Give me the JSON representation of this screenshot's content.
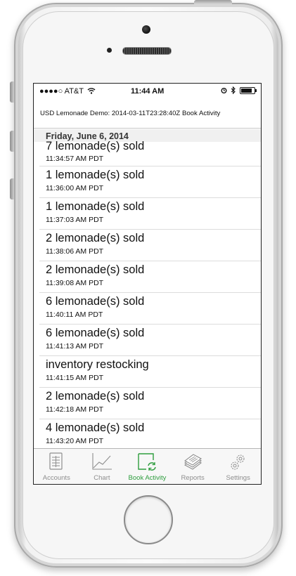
{
  "status_bar": {
    "carrier": "●●●●○ AT&T",
    "time": "11:44 AM",
    "battery_level": 0.85
  },
  "nav": {
    "title": "USD Lemonade Demo: 2014-03-11T23:28:40Z Book Activity"
  },
  "section": {
    "header": "Friday, June 6, 2014"
  },
  "entries": [
    {
      "title": "7 lemonade(s) sold",
      "time": "11:34:57 AM PDT"
    },
    {
      "title": "1 lemonade(s) sold",
      "time": "11:36:00 AM PDT"
    },
    {
      "title": "1 lemonade(s) sold",
      "time": "11:37:03 AM PDT"
    },
    {
      "title": "2 lemonade(s) sold",
      "time": "11:38:06 AM PDT"
    },
    {
      "title": "2 lemonade(s) sold",
      "time": "11:39:08 AM PDT"
    },
    {
      "title": "6 lemonade(s) sold",
      "time": "11:40:11 AM PDT"
    },
    {
      "title": "6 lemonade(s) sold",
      "time": "11:41:13 AM PDT"
    },
    {
      "title": "inventory restocking",
      "time": "11:41:15 AM PDT"
    },
    {
      "title": "2 lemonade(s) sold",
      "time": "11:42:18 AM PDT"
    },
    {
      "title": "4 lemonade(s) sold",
      "time": "11:43:20 AM PDT"
    }
  ],
  "tabs": [
    {
      "label": "Accounts",
      "icon": "accounts-icon",
      "active": false
    },
    {
      "label": "Chart",
      "icon": "chart-icon",
      "active": false
    },
    {
      "label": "Book Activity",
      "icon": "book-activity-icon",
      "active": true
    },
    {
      "label": "Reports",
      "icon": "reports-icon",
      "active": false
    },
    {
      "label": "Settings",
      "icon": "settings-icon",
      "active": false
    }
  ],
  "colors": {
    "accent": "#2e9d3e",
    "inactive_tab": "#8e8e8e"
  }
}
